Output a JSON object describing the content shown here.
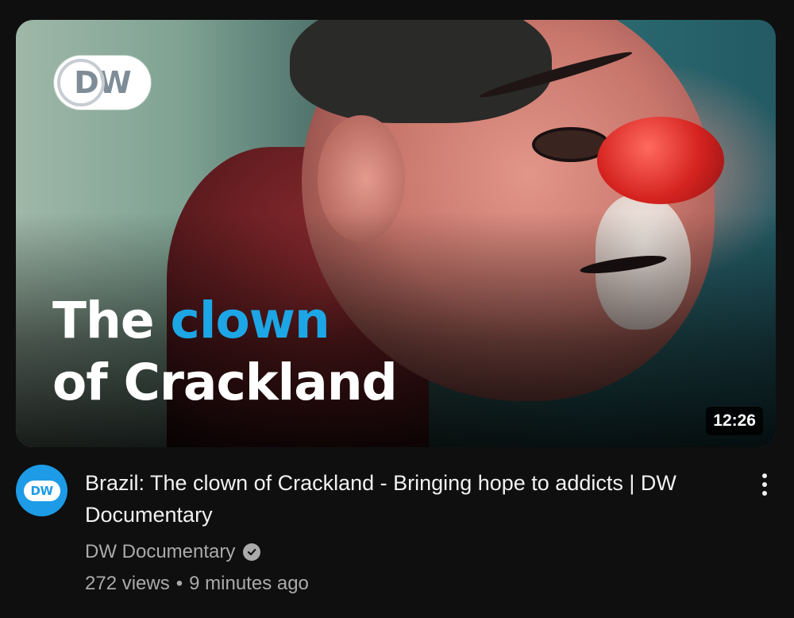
{
  "thumbnail": {
    "logo_text": "DW",
    "overlay_line1_word1": "The",
    "overlay_line1_word2": "clown",
    "overlay_line2": "of Crackland",
    "accent_color": "#1da6e6",
    "duration": "12:26"
  },
  "channel": {
    "avatar_text": "DW",
    "avatar_color": "#1d9be6",
    "name": "DW Documentary",
    "verified_icon": "verified-check-icon"
  },
  "video": {
    "title": "Brazil: The clown of Crackland - Bringing hope to addicts | DW Documentary",
    "views": "272 views",
    "separator": "•",
    "age": "9 minutes ago"
  },
  "actions": {
    "menu_icon": "more-vert-icon"
  }
}
